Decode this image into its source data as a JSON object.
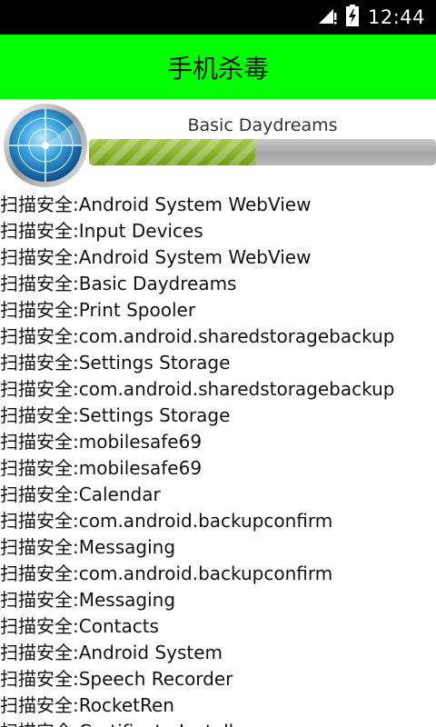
{
  "status_bar": {
    "time": "12:44"
  },
  "header": {
    "title": "手机杀毒"
  },
  "scan": {
    "current_app": "Basic Daydreams",
    "progress": 0.48
  },
  "log": [
    "扫描安全:Android System WebView",
    "扫描安全:Input Devices",
    "扫描安全:Android System WebView",
    "扫描安全:Basic Daydreams",
    "扫描安全:Print Spooler",
    "扫描安全:com.android.sharedstoragebackup",
    "扫描安全:Settings Storage",
    "扫描安全:com.android.sharedstoragebackup",
    "扫描安全:Settings Storage",
    "扫描安全:mobilesafe69",
    "扫描安全:mobilesafe69",
    "扫描安全:Calendar",
    "扫描安全:com.android.backupconfirm",
    "扫描安全:Messaging",
    "扫描安全:com.android.backupconfirm",
    "扫描安全:Messaging",
    "扫描安全:Contacts",
    "扫描安全:Android System",
    "扫描安全:Speech Recorder",
    "扫描安全:RocketRen",
    "扫描安全:Certificate Installer"
  ]
}
